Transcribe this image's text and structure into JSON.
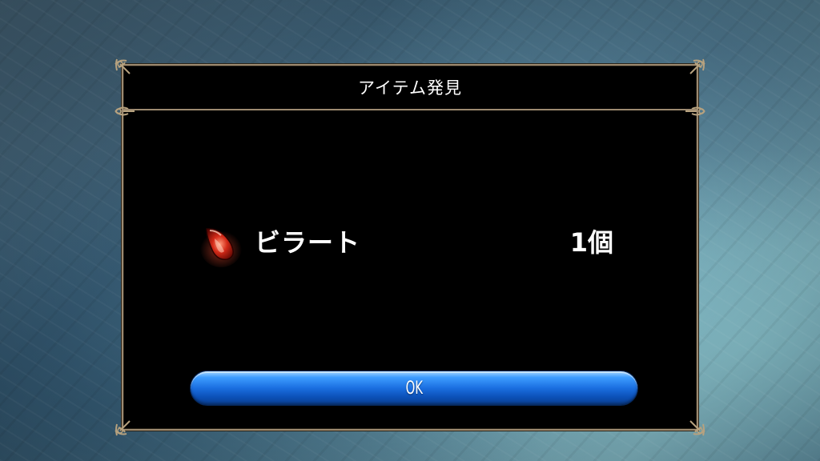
{
  "dialog": {
    "title": "アイテム発見",
    "frame_color": "#9d8a70"
  },
  "item": {
    "icon": "red-crystal-icon",
    "name": "ビラート",
    "quantity": "1個"
  },
  "ok_button": {
    "label": "OK",
    "color": "#1a6ee0"
  }
}
